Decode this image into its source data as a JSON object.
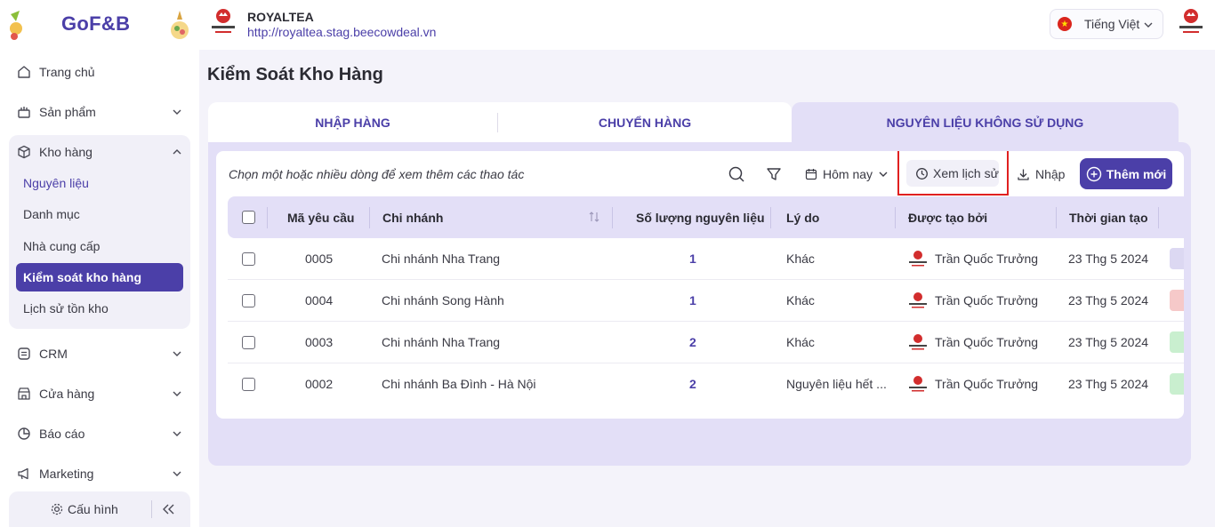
{
  "brand": {
    "name": "GoF&B"
  },
  "header": {
    "store_name": "ROYALTEA",
    "store_url": "http://royaltea.stag.beecowdeal.vn",
    "language": "Tiếng Việt"
  },
  "sidebar": {
    "items": [
      {
        "label": "Trang chủ",
        "icon": "home-icon"
      },
      {
        "label": "Sản phẩm",
        "icon": "product-icon"
      },
      {
        "label": "Kho hàng",
        "icon": "box-icon"
      },
      {
        "label": "CRM",
        "icon": "crm-icon"
      },
      {
        "label": "Cửa hàng",
        "icon": "store-icon"
      },
      {
        "label": "Báo cáo",
        "icon": "chart-pie-icon"
      },
      {
        "label": "Marketing",
        "icon": "megaphone-icon"
      }
    ],
    "warehouse_sub": [
      {
        "label": "Nguyên liệu"
      },
      {
        "label": "Danh mục"
      },
      {
        "label": "Nhà cung cấp"
      },
      {
        "label": "Kiểm soát kho hàng"
      },
      {
        "label": "Lịch sử tồn kho"
      }
    ],
    "settings_label": "Cấu hình"
  },
  "page": {
    "title": "Kiểm Soát Kho Hàng",
    "tabs": [
      {
        "label": "NHẬP HÀNG"
      },
      {
        "label": "CHUYỂN HÀNG"
      },
      {
        "label": "NGUYÊN LIỆU KHÔNG SỬ DỤNG"
      }
    ],
    "active_tab": "NGUYÊN LIỆU KHÔNG SỬ DỤNG"
  },
  "toolbar": {
    "hint": "Chọn một hoặc nhiều dòng để xem thêm các thao tác",
    "date_filter": "Hôm nay",
    "history_label": "Xem lịch sử",
    "import_label": "Nhập",
    "add_label": "Thêm mới"
  },
  "table": {
    "columns": [
      "Mã yêu cầu",
      "Chi nhánh",
      "Số lượng nguyên liệu",
      "Lý do",
      "Được tạo bởi",
      "Thời gian tạo"
    ],
    "rows": [
      {
        "code": "0005",
        "branch": "Chi nhánh Nha Trang",
        "qty": "1",
        "reason": "Khác",
        "creator": "Trần Quốc Trưởng",
        "time": "23 Thg 5 2024",
        "status_color": "#dcd8f2"
      },
      {
        "code": "0004",
        "branch": "Chi nhánh Song Hành",
        "qty": "1",
        "reason": "Khác",
        "creator": "Trần Quốc Trưởng",
        "time": "23 Thg 5 2024",
        "status_color": "#f6c9c9"
      },
      {
        "code": "0003",
        "branch": "Chi nhánh Nha Trang",
        "qty": "2",
        "reason": "Khác",
        "creator": "Trần Quốc Trưởng",
        "time": "23 Thg 5 2024",
        "status_color": "#c9efcf"
      },
      {
        "code": "0002",
        "branch": "Chi nhánh Ba Đình - Hà Nội",
        "qty": "2",
        "reason": "Nguyên liệu hết ...",
        "creator": "Trần Quốc Trưởng",
        "time": "23 Thg 5 2024",
        "status_color": "#c9efcf"
      }
    ]
  },
  "colors": {
    "accent": "#4b3fa8",
    "accent_light": "#e3dff7",
    "highlight": "#e02020"
  }
}
